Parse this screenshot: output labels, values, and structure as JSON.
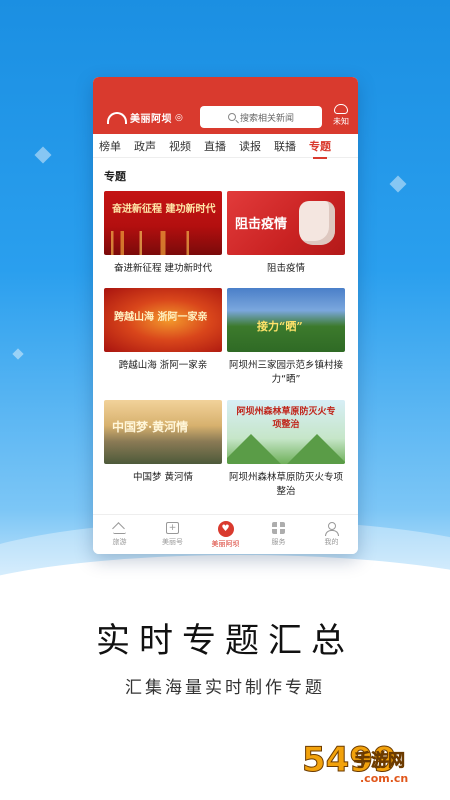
{
  "app": {
    "logo_text": "美丽阿坝",
    "search_placeholder": "搜索相关新闻",
    "weather_label": "未知"
  },
  "tabs": [
    {
      "label": "榜单"
    },
    {
      "label": "政声"
    },
    {
      "label": "视频"
    },
    {
      "label": "直播"
    },
    {
      "label": "读报"
    },
    {
      "label": "联播"
    },
    {
      "label": "专题",
      "active": true
    }
  ],
  "section_title": "专题",
  "cards": [
    {
      "caption": "奋进新征程 建功新时代",
      "thumb_text": "奋进新征程 建功新时代"
    },
    {
      "caption": "阻击疫情",
      "thumb_text": "阻击疫情"
    },
    {
      "caption": "跨越山海 浙阿一家亲",
      "thumb_text": "跨越山海 浙阿一家亲"
    },
    {
      "caption": "阿坝州三家园示范乡镇村接力“晒”",
      "thumb_text": "接力“晒”"
    },
    {
      "caption": "中国梦 黄河情",
      "thumb_text": "中国梦·黄河情"
    },
    {
      "caption": "阿坝州森林草原防灭火专项整治",
      "thumb_text": "阿坝州森林草原防灭火专项整治"
    }
  ],
  "bottom_nav": [
    {
      "label": "旅游",
      "icon": "mountain-icon"
    },
    {
      "label": "美丽号",
      "icon": "plus-box-icon"
    },
    {
      "label": "美丽阿坝",
      "icon": "heart-icon",
      "active": true
    },
    {
      "label": "服务",
      "icon": "grid-icon"
    },
    {
      "label": "我的",
      "icon": "user-icon"
    }
  ],
  "promo": {
    "headline": "实时专题汇总",
    "subline": "汇集海量实时制作专题"
  },
  "watermark": {
    "number": "5499",
    "cn": "手游网",
    "url": ".com.cn"
  },
  "colors": {
    "brand_red": "#d93a2e",
    "background_blue": "#1b8fe2"
  }
}
